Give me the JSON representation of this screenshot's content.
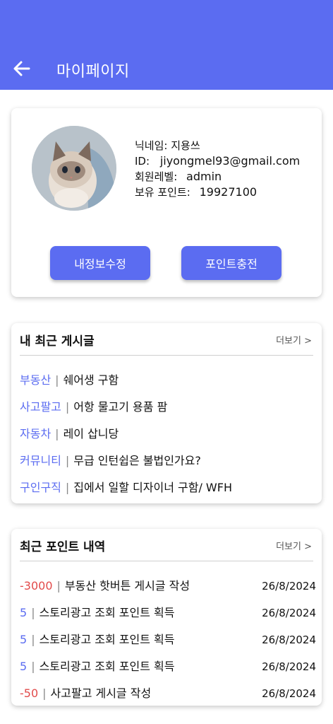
{
  "header": {
    "title": "마이페이지",
    "back_icon": "arrow-left-icon"
  },
  "profile": {
    "nickname_label": "닉네임:",
    "nickname": "지용쓰",
    "id_label": "ID:",
    "id": "jiyongmel93@gmail.com",
    "level_label": "회원레벨:",
    "level": "admin",
    "points_label": "보유 포인트:",
    "points": "19927100",
    "edit_button": "내정보수정",
    "charge_button": "포인트충전"
  },
  "recent_posts": {
    "title": "내 최근 게시글",
    "more": "더보기 >",
    "items": [
      {
        "category": "부동산",
        "text": "쉐어생 구함"
      },
      {
        "category": "사고팔고",
        "text": "어항 물고기 용품 팜"
      },
      {
        "category": "자동차",
        "text": "레이 삽니당"
      },
      {
        "category": "커뮤니티",
        "text": "무급 인턴쉽은 불법인가요?"
      },
      {
        "category": "구인구직",
        "text": "집에서 일할 디자이너 구함/ WFH"
      }
    ]
  },
  "recent_points": {
    "title": "최근 포인트 내역",
    "more": "더보기 >",
    "items": [
      {
        "amount": "-3000",
        "text": "부동산 핫버튼 게시글 작성",
        "date": "26/8/2024"
      },
      {
        "amount": "5",
        "text": "스토리광고 조회 포인트 획득",
        "date": "26/8/2024"
      },
      {
        "amount": "5",
        "text": "스토리광고 조회 포인트 획득",
        "date": "26/8/2024"
      },
      {
        "amount": "5",
        "text": "스토리광고 조회 포인트 획득",
        "date": "26/8/2024"
      },
      {
        "amount": "-50",
        "text": "사고팔고 게시글 작성",
        "date": "26/8/2024"
      }
    ]
  },
  "colors": {
    "accent": "#5b6cf1",
    "negative": "#e24b4b"
  }
}
